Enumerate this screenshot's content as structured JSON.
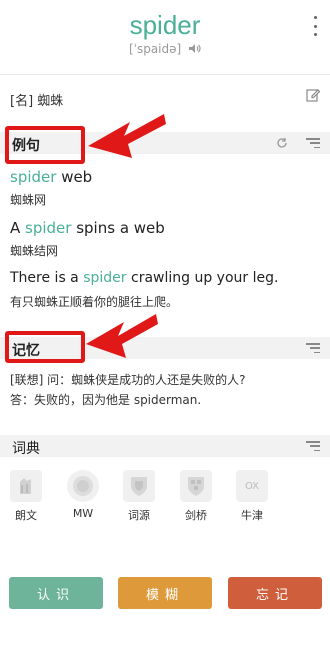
{
  "word": "spider",
  "phonetic": "[ˈspaidə]",
  "definition": "[名] 蜘蛛",
  "sections": {
    "examples_title": "例句",
    "memory_title": "记忆",
    "dictionary_title": "词典"
  },
  "examples": [
    {
      "pre": "",
      "hl": "spider",
      "post": " web",
      "zh": "蜘蛛网"
    },
    {
      "pre": "A ",
      "hl": "spider",
      "post": " spins a web",
      "zh": "蜘蛛结网"
    },
    {
      "pre": "There is a ",
      "hl": "spider",
      "post": " crawling up your leg.",
      "zh": "有只蜘蛛正顺着你的腿往上爬。"
    }
  ],
  "memory": {
    "line1": "[联想] 问：蜘蛛侠是成功的人还是失败的人?",
    "line2": "答：失败的，因为他是 spiderman."
  },
  "dictionaries": [
    {
      "label": "朗文",
      "icon": "longman-icon"
    },
    {
      "label": "MW",
      "icon": "merriam-webster-icon"
    },
    {
      "label": "词源",
      "icon": "etymology-icon"
    },
    {
      "label": "剑桥",
      "icon": "cambridge-icon"
    },
    {
      "label": "牛津",
      "icon": "oxford-icon",
      "text": "OX"
    }
  ],
  "buttons": {
    "know": "认识",
    "vague": "模糊",
    "forget": "忘记"
  },
  "colors": {
    "accent": "#4ab098",
    "know": "#6db49a",
    "vague": "#de9a3a",
    "forget": "#cf5f3c",
    "annotation": "#e01818"
  }
}
